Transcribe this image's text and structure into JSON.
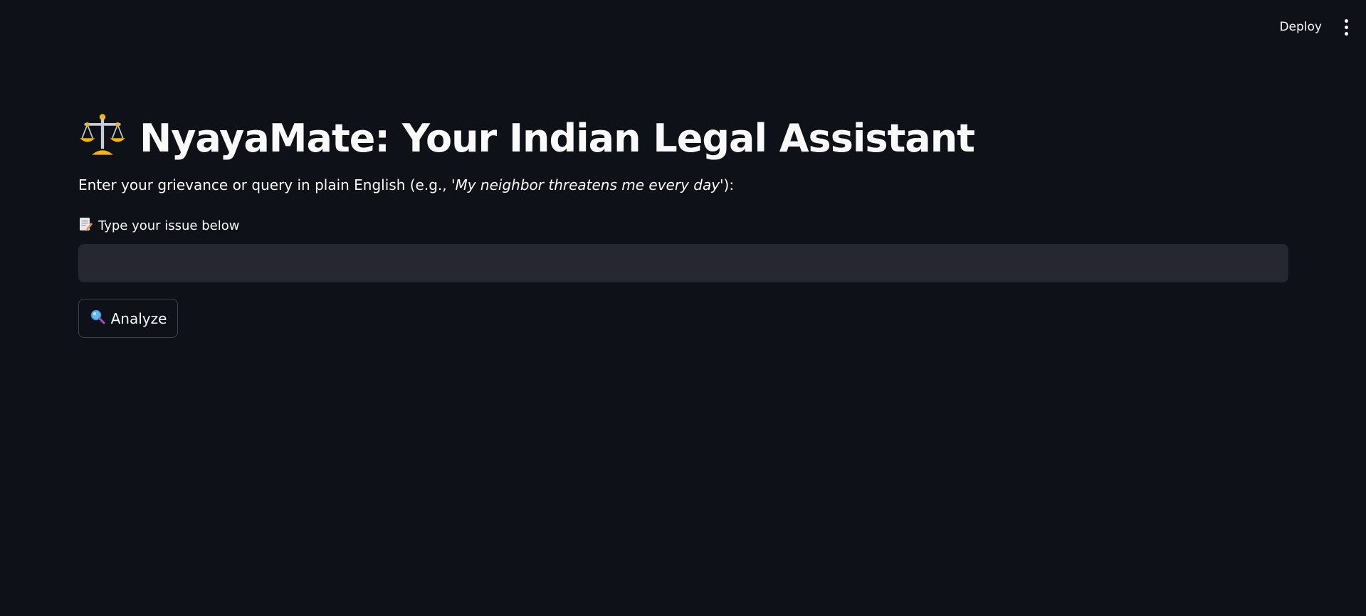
{
  "toolbar": {
    "deploy_label": "Deploy",
    "menu_icon": "more-vertical-icon"
  },
  "header": {
    "title_icon": "balance-scale-icon",
    "title": "NyayaMate: Your Indian Legal Assistant"
  },
  "intro": {
    "prefix": "Enter your grievance or query in plain English (e.g., ",
    "example": "'My neighbor threatens me every day'",
    "suffix": "):"
  },
  "issue_input": {
    "label_icon": "memo-icon",
    "label": "Type your issue below",
    "value": "",
    "placeholder": ""
  },
  "analyze_button": {
    "icon": "magnifying-glass-icon",
    "label": "Analyze"
  },
  "colors": {
    "background": "#0e1117",
    "input_background": "#262730",
    "text": "#fafafa",
    "button_border": "#3d4250"
  }
}
